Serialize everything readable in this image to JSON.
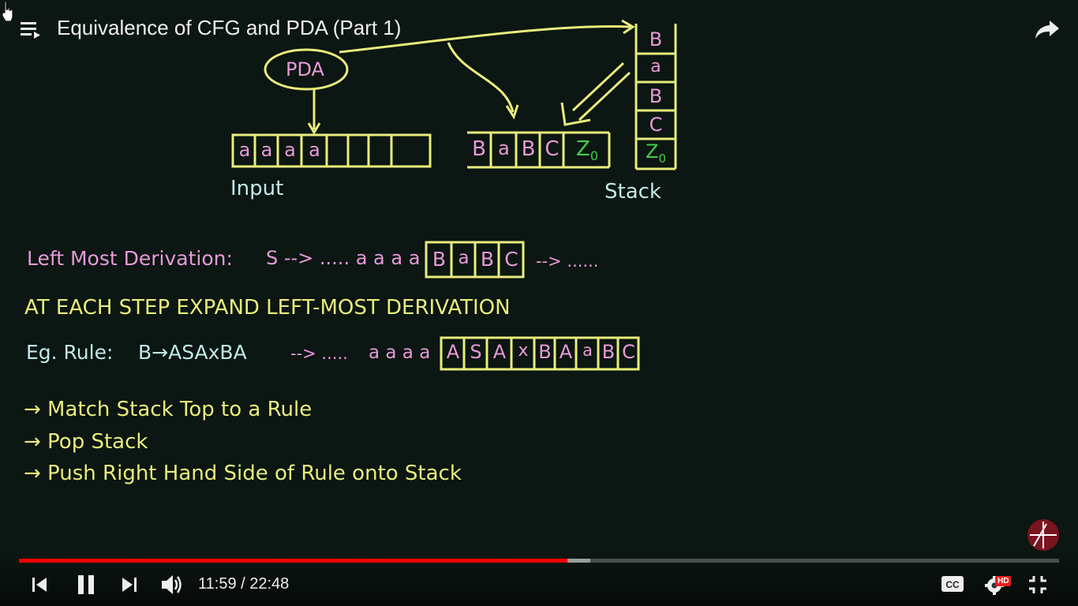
{
  "header": {
    "title": "Equivalence of CFG and PDA (Part 1)",
    "playlist_icon": "playlist-icon",
    "share_icon": "share-icon"
  },
  "diagram": {
    "pda_label": "PDA",
    "input_cells": [
      "a",
      "a",
      "a",
      "a",
      "",
      "",
      "",
      ""
    ],
    "input_label": "Input",
    "stack_row_cells": [
      "B",
      "a",
      "B",
      "C"
    ],
    "stack_row_bottom": "Z",
    "stack_row_bottom_sub": "0",
    "stack_column_cells": [
      "B",
      "a",
      "B",
      "C"
    ],
    "stack_column_bottom": "Z",
    "stack_column_bottom_sub": "0",
    "stack_label": "Stack"
  },
  "notes": {
    "lmd_label": "Left Most Derivation:",
    "lmd_expr": "S --> ..... a a a a",
    "lmd_cells": [
      "B",
      "a",
      "B",
      "C"
    ],
    "lmd_tail": "--> ......",
    "heading": "AT EACH STEP EXPAND LEFT-MOST DERIVATION",
    "eg_label": "Eg.  Rule:",
    "eg_rule": "B→ASAxBA",
    "eg_arrow": "--> .....",
    "eg_prefix": "a a a a",
    "eg_cells": [
      "A",
      "S",
      "A",
      "x",
      "B",
      "A",
      "a",
      "B",
      "C"
    ],
    "steps": [
      "→ Match Stack Top to a Rule",
      "→ Pop Stack",
      "→ Push Right Hand Side of Rule onto Stack"
    ]
  },
  "player": {
    "current_time": "11:59",
    "separator": "/",
    "duration": "22:48",
    "time_text": "11:59 / 22:48",
    "played_fraction": 0.527,
    "buffered_fraction": 0.549,
    "hd_badge": "HD",
    "icons": [
      "previous-icon",
      "pause-icon",
      "next-icon",
      "volume-icon",
      "captions-icon",
      "settings-icon",
      "exit-fullscreen-icon"
    ],
    "colors": {
      "progress": "#ff0000",
      "hd_badge": "#e52020"
    }
  }
}
